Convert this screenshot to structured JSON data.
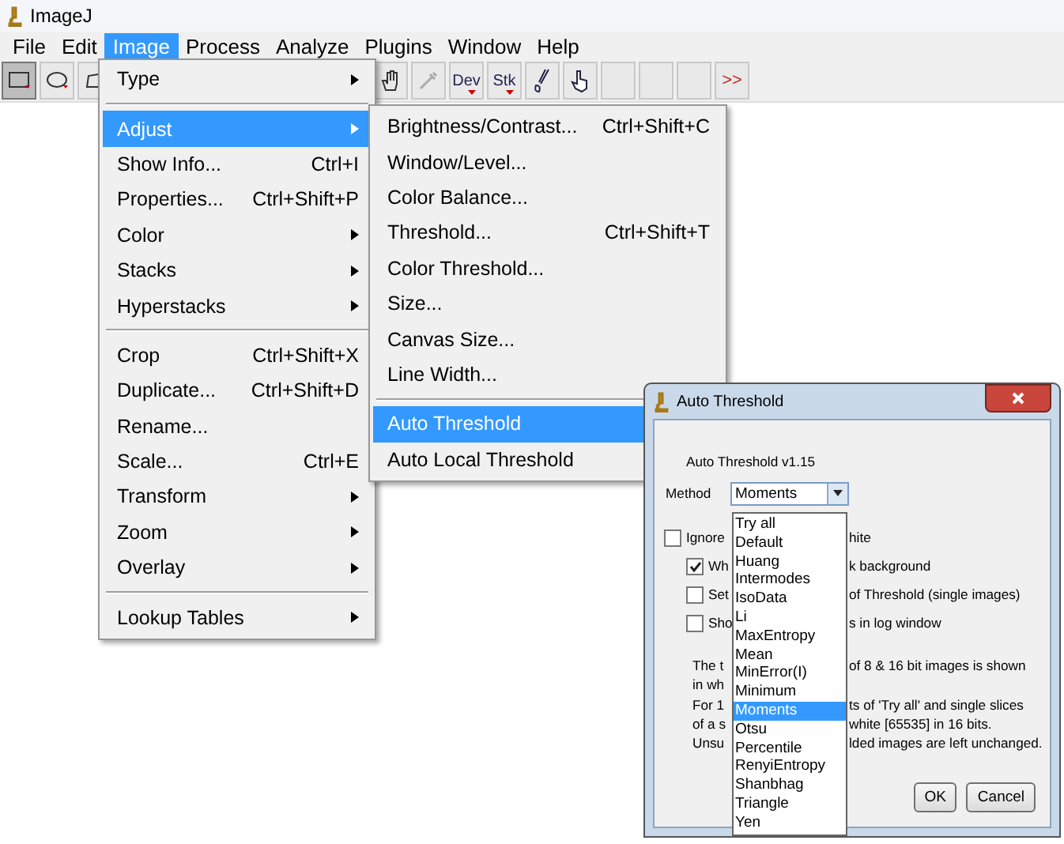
{
  "window": {
    "title": "ImageJ"
  },
  "menubar": [
    {
      "label": "File",
      "selected": false
    },
    {
      "label": "Edit",
      "selected": false
    },
    {
      "label": "Image",
      "selected": true
    },
    {
      "label": "Process",
      "selected": false
    },
    {
      "label": "Analyze",
      "selected": false
    },
    {
      "label": "Plugins",
      "selected": false
    },
    {
      "label": "Window",
      "selected": false
    },
    {
      "label": "Help",
      "selected": false
    }
  ],
  "toolbar": {
    "left_tools": [
      {
        "kind": "rect",
        "selected": true
      },
      {
        "kind": "oval",
        "selected": false
      },
      {
        "kind": "polygon",
        "selected": false
      }
    ],
    "right_tools": [
      {
        "kind": "hand",
        "selected": false
      },
      {
        "kind": "dropper",
        "selected": false
      },
      {
        "kind": "text-menu",
        "label": "Dev",
        "selected": false
      },
      {
        "kind": "text-menu",
        "label": "Stk",
        "selected": false
      },
      {
        "kind": "brush",
        "selected": false
      },
      {
        "kind": "pointer",
        "selected": false
      },
      {
        "kind": "empty",
        "selected": false
      },
      {
        "kind": "empty",
        "selected": false
      },
      {
        "kind": "empty",
        "selected": false
      },
      {
        "kind": "more",
        "label": ">>",
        "selected": false
      }
    ]
  },
  "image_menu": [
    {
      "kind": "item",
      "label": "Type",
      "submenu": true,
      "selected": false
    },
    {
      "kind": "separator"
    },
    {
      "kind": "item",
      "label": "Adjust",
      "submenu": true,
      "selected": true
    },
    {
      "kind": "item",
      "label": "Show Info...",
      "shortcut": "Ctrl+I",
      "selected": false
    },
    {
      "kind": "item",
      "label": "Properties...",
      "shortcut": "Ctrl+Shift+P",
      "selected": false
    },
    {
      "kind": "item",
      "label": "Color",
      "submenu": true,
      "selected": false
    },
    {
      "kind": "item",
      "label": "Stacks",
      "submenu": true,
      "selected": false
    },
    {
      "kind": "item",
      "label": "Hyperstacks",
      "submenu": true,
      "selected": false
    },
    {
      "kind": "separator"
    },
    {
      "kind": "item",
      "label": "Crop",
      "shortcut": "Ctrl+Shift+X",
      "selected": false
    },
    {
      "kind": "item",
      "label": "Duplicate...",
      "shortcut": "Ctrl+Shift+D",
      "selected": false
    },
    {
      "kind": "item",
      "label": "Rename...",
      "selected": false
    },
    {
      "kind": "item",
      "label": "Scale...",
      "shortcut": "Ctrl+E",
      "selected": false
    },
    {
      "kind": "item",
      "label": "Transform",
      "submenu": true,
      "selected": false
    },
    {
      "kind": "item",
      "label": "Zoom",
      "submenu": true,
      "selected": false
    },
    {
      "kind": "item",
      "label": "Overlay",
      "submenu": true,
      "selected": false
    },
    {
      "kind": "separator"
    },
    {
      "kind": "item",
      "label": "Lookup Tables",
      "submenu": true,
      "selected": false
    }
  ],
  "adjust_menu": [
    {
      "kind": "item",
      "label": "Brightness/Contrast...",
      "shortcut": "Ctrl+Shift+C",
      "selected": false
    },
    {
      "kind": "item",
      "label": "Window/Level...",
      "selected": false
    },
    {
      "kind": "item",
      "label": "Color Balance...",
      "selected": false
    },
    {
      "kind": "item",
      "label": "Threshold...",
      "shortcut": "Ctrl+Shift+T",
      "selected": false
    },
    {
      "kind": "item",
      "label": "Color Threshold...",
      "selected": false
    },
    {
      "kind": "item",
      "label": "Size...",
      "selected": false
    },
    {
      "kind": "item",
      "label": "Canvas Size...",
      "selected": false
    },
    {
      "kind": "item",
      "label": "Line Width...",
      "selected": false
    },
    {
      "kind": "separator"
    },
    {
      "kind": "item",
      "label": "Auto Threshold",
      "selected": true
    },
    {
      "kind": "item",
      "label": "Auto Local Threshold",
      "selected": false
    }
  ],
  "dialog": {
    "title": "Auto Threshold",
    "version": "Auto Threshold v1.15",
    "method_label": "Method",
    "method_value": "Moments",
    "options": [
      {
        "left": "Ignore",
        "right": "hite",
        "checked": false,
        "children": [
          {
            "left": "Wh",
            "right": "k background",
            "checked": true
          },
          {
            "left": "Set",
            "right": "of Threshold (single images)",
            "checked": false
          },
          {
            "left": "Sho",
            "right": "s in log window",
            "checked": false
          }
        ]
      }
    ],
    "notes": [
      {
        "left": "The t",
        "right": "of 8 & 16 bit images is shown"
      },
      {
        "left": "in wh"
      },
      {
        "left": "For 1",
        "right": "ts of 'Try all' and single slices"
      },
      {
        "left": "of a s",
        "right": "white [65535] in 16 bits."
      },
      {
        "left": "Unsu",
        "right": "lded images are left unchanged."
      }
    ],
    "method_options": [
      {
        "label": "Try all",
        "selected": false
      },
      {
        "label": "Default",
        "selected": false
      },
      {
        "label": "Huang",
        "selected": false
      },
      {
        "label": "Intermodes",
        "selected": false
      },
      {
        "label": "IsoData",
        "selected": false
      },
      {
        "label": "Li",
        "selected": false
      },
      {
        "label": "MaxEntropy",
        "selected": false
      },
      {
        "label": "Mean",
        "selected": false
      },
      {
        "label": "MinError(I)",
        "selected": false
      },
      {
        "label": "Minimum",
        "selected": false
      },
      {
        "label": "Moments",
        "selected": true
      },
      {
        "label": "Otsu",
        "selected": false
      },
      {
        "label": "Percentile",
        "selected": false
      },
      {
        "label": "RenyiEntropy",
        "selected": false
      },
      {
        "label": "Shanbhag",
        "selected": false
      },
      {
        "label": "Triangle",
        "selected": false
      },
      {
        "label": "Yen",
        "selected": false
      }
    ],
    "buttons": [
      "OK",
      "Cancel"
    ]
  }
}
